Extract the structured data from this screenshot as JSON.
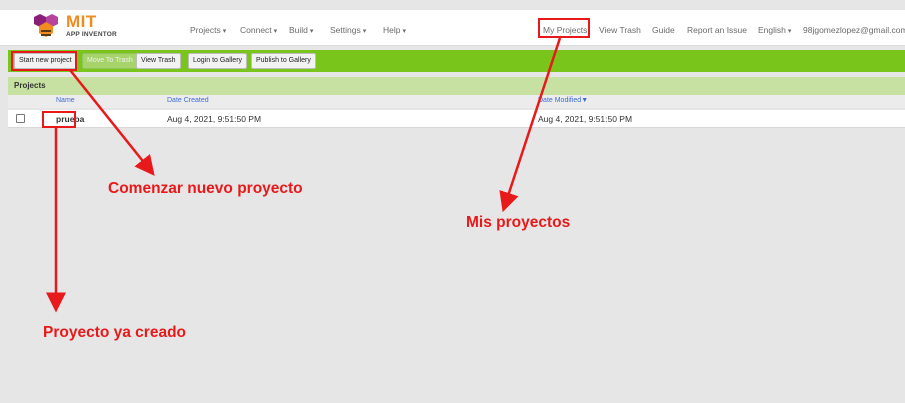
{
  "logo": {
    "title": "MIT",
    "subtitle": "APP INVENTOR"
  },
  "menu": {
    "projects": "Projects",
    "connect": "Connect",
    "build": "Build",
    "settings": "Settings",
    "help": "Help",
    "my_projects": "My Projects",
    "view_trash": "View Trash",
    "guide": "Guide",
    "report_issue": "Report an Issue",
    "language": "English",
    "account": "98jgomezlopez@gmail.com"
  },
  "toolbar": {
    "start_new_project": "Start new project",
    "move_to_trash": "Move To Trash",
    "view_trash": "View Trash",
    "login_gallery": "Login to Gallery",
    "publish_gallery": "Publish to Gallery"
  },
  "projects": {
    "title": "Projects",
    "columns": {
      "name": "Name",
      "date_created": "Date Created",
      "date_modified": "Date Modified"
    },
    "sort_indicator": "▼",
    "rows": [
      {
        "name": "prueba",
        "date_created": "Aug 4, 2021, 9:51:50 PM",
        "date_modified": "Aug 4, 2021, 9:51:50 PM"
      }
    ]
  },
  "annotations": {
    "start_new": "Comenzar nuevo proyecto",
    "my_projects": "Mis proyectos",
    "existing_project": "Proyecto ya creado"
  },
  "colors": {
    "toolbar_green": "#79c51b",
    "projects_bar": "#c6e1a2",
    "annotation_red": "#e8191a",
    "link_blue": "#3f6bd6",
    "logo_orange": "#f08c1e"
  }
}
